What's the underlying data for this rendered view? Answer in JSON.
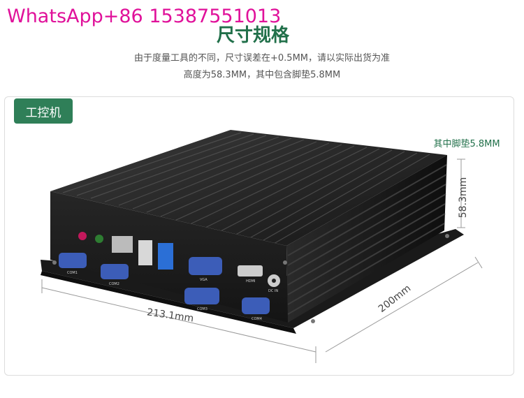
{
  "watermark": "WhatsApp+86 15387551013",
  "header": {
    "title": "尺寸规格",
    "note_line1": "由于度量工具的不同，尺寸误差在+0.5MM，请以实际出货为准",
    "note_line2": "高度为58.3MM，其中包含脚垫5.8MM"
  },
  "product": {
    "tag": "工控机",
    "foot_label": "其中脚垫5.8MM",
    "height_label": "58.3mm",
    "width_label": "213.1mm",
    "depth_label": "200mm",
    "port_labels": {
      "com1": "COM1",
      "com2": "COM2",
      "com3": "COM3",
      "com4": "COM4",
      "vga": "VGA",
      "hdmi": "HDMI",
      "dcin": "DC IN"
    }
  },
  "colors": {
    "watermark": "#e0119a",
    "accent_green": "#2f7f58",
    "device_body": "#1c1c1c"
  }
}
